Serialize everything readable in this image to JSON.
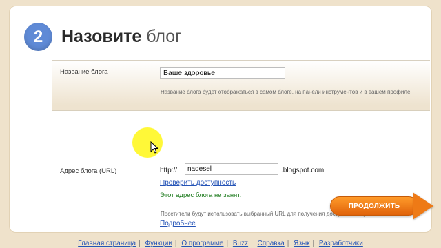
{
  "step": {
    "number": "2",
    "title_bold": "Назовите",
    "title_light": "блог"
  },
  "blog_name": {
    "label": "Название блога",
    "value": "Ваше здоровье",
    "hint": "Название блога будет отображаться в самом блоге, на панели инструментов и в вашем профиле."
  },
  "blog_address": {
    "label": "Адрес блога (URL)",
    "prefix": "http://",
    "value": "nadesel",
    "suffix": ".blogspot.com",
    "check_link": "Проверить доступность",
    "status": "Этот адрес блога не занят.",
    "hint": "Посетители будут использовать выбранный URL для получения доступа к блогу.",
    "more_link": "Подробнее"
  },
  "continue_button": "ПРОДОЛЖИТЬ",
  "footer": {
    "links": [
      "Главная страница",
      "Функции",
      "О программе",
      "Buzz",
      "Справка",
      "Язык",
      "Разработчики"
    ],
    "separator": "|"
  },
  "colors": {
    "step_circle": "#5f8ad6",
    "button": "#ee7a16",
    "link": "#2554b7",
    "status_ok": "#1c7a1c",
    "background": "#efe2cb"
  }
}
